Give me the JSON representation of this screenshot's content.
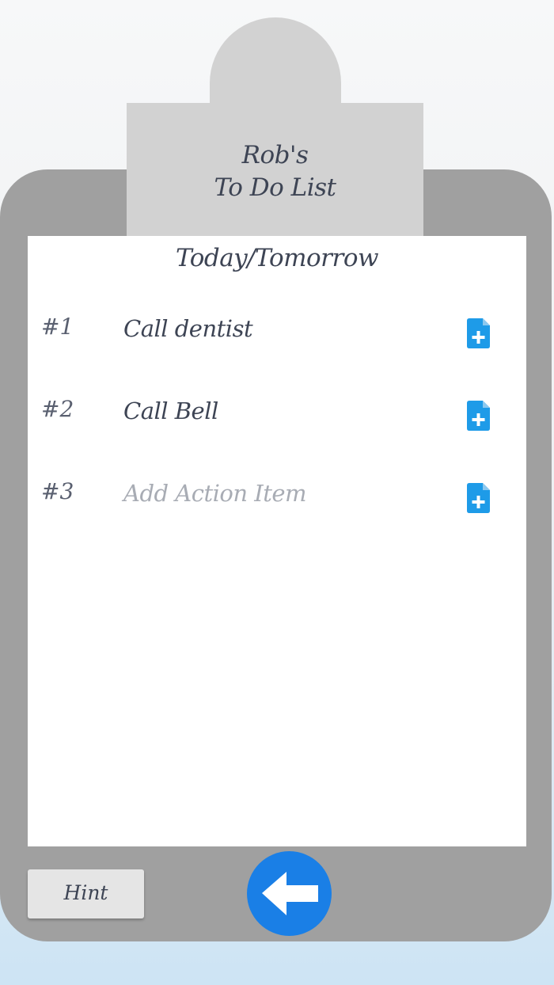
{
  "header": {
    "title_line1": "Rob's",
    "title_line2": "To Do List"
  },
  "section": {
    "title": "Today/Tomorrow"
  },
  "items": [
    {
      "number": "#1",
      "text": "Call dentist",
      "icon": "add-document-icon"
    },
    {
      "number": "#2",
      "text": "Call Bell",
      "icon": "add-document-icon"
    },
    {
      "number": "#3",
      "placeholder": "Add Action Item",
      "icon": "add-document-icon"
    }
  ],
  "footer": {
    "hint_label": "Hint",
    "back_icon": "arrow-left-icon"
  },
  "colors": {
    "board": "#a0a0a0",
    "clip": "#d2d2d2",
    "paper": "#ffffff",
    "text": "#3d4454",
    "placeholder": "#a8acb4",
    "accent": "#1a7fe6",
    "icon_blue": "#1e9be8"
  }
}
